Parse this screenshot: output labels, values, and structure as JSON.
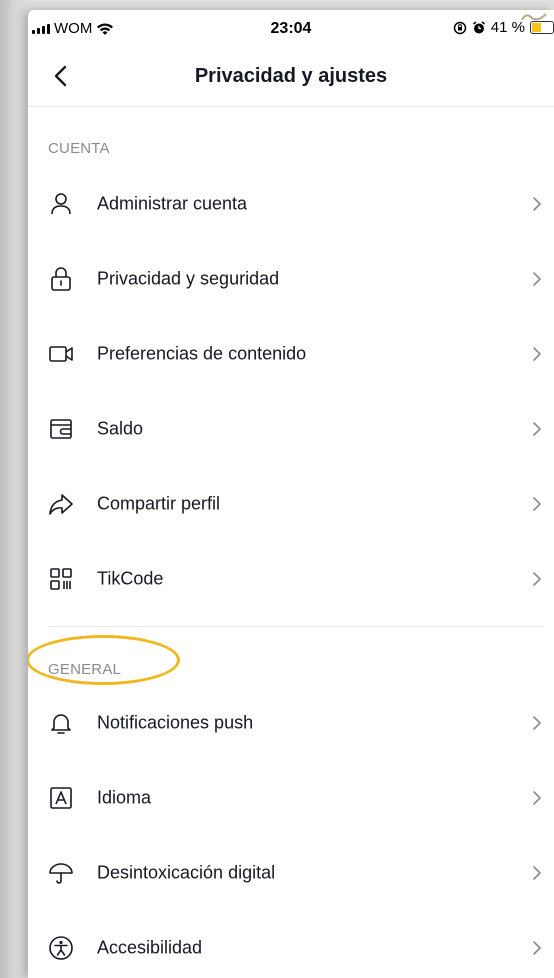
{
  "status_bar": {
    "carrier": "WOM",
    "time": "23:04",
    "battery": "41 %",
    "battery_level": 0.41
  },
  "nav": {
    "title": "Privacidad y ajustes"
  },
  "sections": [
    {
      "header": "CUENTA",
      "items": [
        {
          "label": "Administrar cuenta",
          "icon": "person-icon"
        },
        {
          "label": "Privacidad y seguridad",
          "icon": "lock-icon"
        },
        {
          "label": "Preferencias de contenido",
          "icon": "video-camera-icon"
        },
        {
          "label": "Saldo",
          "icon": "wallet-icon"
        },
        {
          "label": "Compartir perfil",
          "icon": "share-icon"
        },
        {
          "label": "TikCode",
          "icon": "qr-code-icon"
        }
      ]
    },
    {
      "header": "GENERAL",
      "items": [
        {
          "label": "Notificaciones push",
          "icon": "bell-icon"
        },
        {
          "label": "Idioma",
          "icon": "language-icon"
        },
        {
          "label": "Desintoxicación digital",
          "icon": "umbrella-icon"
        },
        {
          "label": "Accesibilidad",
          "icon": "accessibility-icon"
        }
      ]
    }
  ],
  "colors": {
    "highlight": "#f2b61e",
    "text": "#161823",
    "section_header": "#8a8b91"
  }
}
